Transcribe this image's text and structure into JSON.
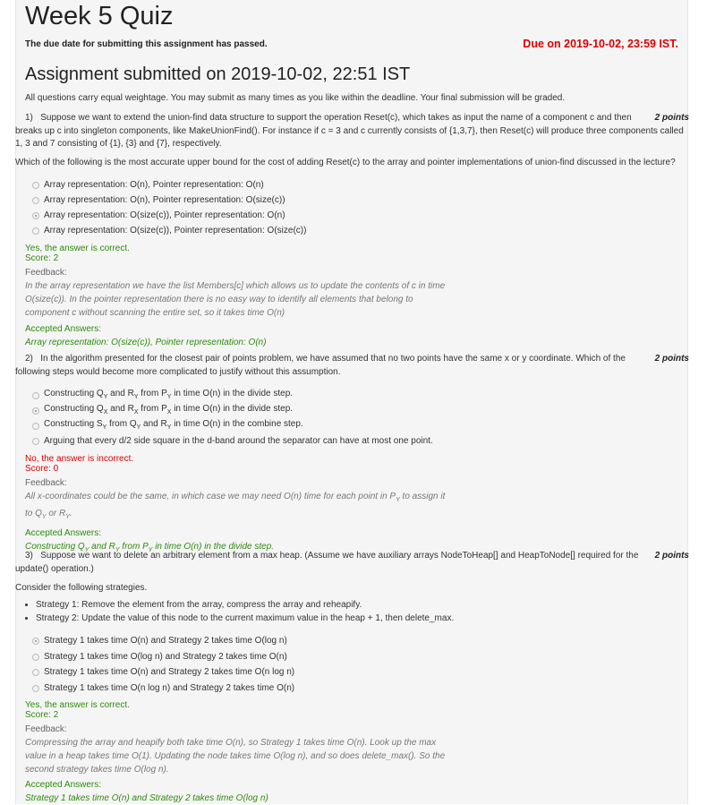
{
  "title": "Week 5 Quiz",
  "passed_msg": "The due date for submitting this assignment has passed.",
  "due": "Due on 2019-10-02, 23:59 IST.",
  "submitted": "Assignment submitted on 2019-10-02, 22:51 IST",
  "intro": "All questions carry equal weightage. You may submit as many times as you like within the deadline. Your final submission will be graded.",
  "q1": {
    "num": "1)",
    "points": "2 points",
    "text": "Suppose we want to extend the union-find data structure to support the operation Reset(c), which takes as input the name of a component c and then breaks up c into singleton components, like MakeUnionFind(). For instance if c = 3 and c currently consists of {1,3,7}, then Reset(c) will produce three components called 1, 3 and 7 consisting of {1}, {3} and {7}, respectively.",
    "prompt": "Which of the following is the most accurate upper bound for the cost of adding Reset(c) to the array and pointer implementations of union-find discussed in the lecture?",
    "options": [
      "Array representation: O(n), Pointer representation: O(n)",
      "Array representation: O(n), Pointer representation: O(size(c))",
      "Array representation: O(size(c)), Pointer representation: O(n)",
      "Array representation: O(size(c)), Pointer representation: O(size(c))"
    ],
    "selected_index": 2,
    "result": "Yes, the answer is correct.",
    "score": "Score: 2",
    "feedback_label": "Feedback:",
    "feedback": [
      "In the array representation we have the list Members[c] which allows us to update the contents of c in time",
      "O(size(c)). In the pointer representation there is no easy way to identify all elements that belong to",
      "component c without scanning the entire set, so it takes time O(n)"
    ],
    "accepted_label": "Accepted Answers:",
    "accepted": "Array representation: O(size(c)), Pointer representation: O(n)"
  },
  "q2": {
    "num": "2)",
    "points": "2 points",
    "text": "In the algorithm presented for the closest pair of points problem, we have assumed that no two points have the same x or y coordinate. Which of the following steps would become more complicated to justify without this assumption.",
    "options": [
      "Constructing Q<sub>Y</sub> and R<sub>Y</sub> from P<sub>Y</sub> in time O(n) in the divide step.",
      "Constructing Q<sub>X</sub> and R<sub>X</sub> from P<sub>X</sub> in time O(n) in the divide step.",
      "Constructing S<sub>Y</sub> from Q<sub>Y</sub> and R<sub>Y</sub> in time O(n) in the combine step.",
      "Arguing that every d/2 side square in the d-band around the separator can have at most one point."
    ],
    "selected_index": 1,
    "result": "No, the answer is incorrect.",
    "score": "Score: 0",
    "feedback_label": "Feedback:",
    "feedback": [
      "All x-coordinates could be the same, in which case we may need O(n) time for each point in P<sub>Y</sub> to assign it",
      "to Q<sub>Y</sub> or R<sub>Y</sub>."
    ],
    "accepted_label": "Accepted Answers:",
    "accepted": "Constructing Q<sub>Y</sub> and R<sub>Y</sub> from P<sub>Y</sub> in time O(n) in the divide step."
  },
  "q3": {
    "num": "3)",
    "points": "2 points",
    "text": "Suppose we want to delete an arbitrary element from a max heap. (Assume we have auxiliary arrays NodeToHeap[] and HeapToNode[] required for the update() operation.)",
    "prompt": "Consider the following strategies.",
    "strategies": [
      "Strategy 1: Remove the element from the array, compress the array and reheapify.",
      "Strategy 2: Update the value of this node to the current maximum value in the heap + 1, then delete_max."
    ],
    "options": [
      "Strategy 1 takes time O(n) and Strategy 2 takes time O(log n)",
      "Strategy 1 takes time O(log n) and Strategy 2 takes time O(n)",
      "Strategy 1 takes time O(n) and Strategy 2 takes time O(n log n)",
      "Strategy 1 takes time O(n log n) and Strategy 2 takes time O(n)"
    ],
    "selected_index": 0,
    "result": "Yes, the answer is correct.",
    "score": "Score: 2",
    "feedback_label": "Feedback:",
    "feedback": [
      "Compressing the array and heapify both take time O(n), so Strategy 1 takes time O(n). Look up the max",
      "value in a heap takes time O(1). Updating the node takes time O(log n), and so does delete_max(). So the",
      "second strategy takes time O(log n)."
    ],
    "accepted_label": "Accepted Answers:",
    "accepted": "Strategy 1 takes time O(n) and Strategy 2 takes time O(log n)"
  }
}
